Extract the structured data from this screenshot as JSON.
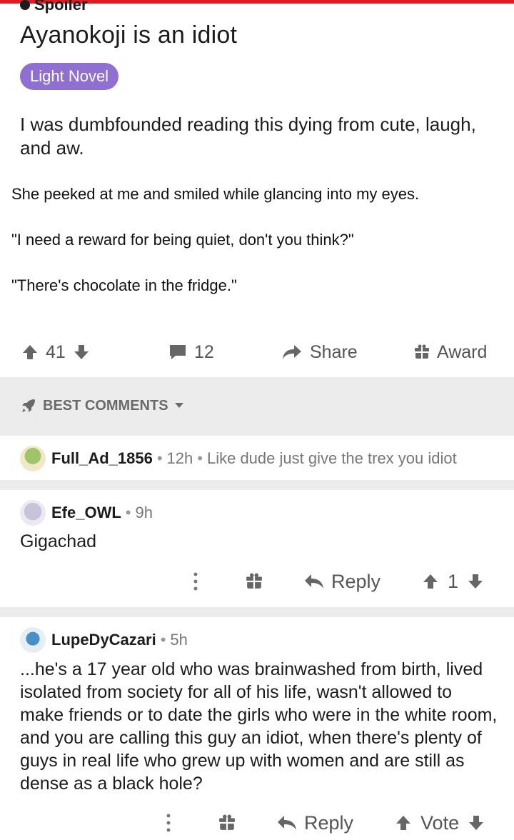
{
  "post": {
    "spoiler_label": "Spoiler",
    "title": "Ayanokoji is an idiot",
    "flair": "Light Novel",
    "body": "I was dumbfounded reading this dying from cute, laugh, and aw.",
    "quotes": [
      "She peeked at me and smiled while glancing into my eyes.",
      "\"I need a reward for being quiet, don't you think?\"",
      "\"There's chocolate in the fridge.\""
    ],
    "votes": "41",
    "comments_count": "12",
    "share_label": "Share",
    "award_label": "Award"
  },
  "sort": {
    "label": "BEST COMMENTS"
  },
  "comments": [
    {
      "user": "Full_Ad_1856",
      "age": "12h",
      "text": "Like dude just give the trex you idiot"
    },
    {
      "user": "Efe_OWL",
      "age": "9h",
      "text": "Gigachad",
      "reply_label": "Reply",
      "votes": "1"
    },
    {
      "user": "LupeDyCazari",
      "age": "5h",
      "text": "...he's a 17 year old who was brainwashed from birth, lived isolated from society for all of his life, wasn't allowed to make friends or to date the girls who were in the white room, and you are calling this guy an idiot, when there's plenty of guys in real life who grew up with women and are still as dense as a black hole?",
      "reply_label": "Reply",
      "vote_label": "Vote"
    }
  ],
  "colors": {
    "accent": "#e01b24",
    "flair": "#8f6fcf",
    "band": "#ececec"
  }
}
